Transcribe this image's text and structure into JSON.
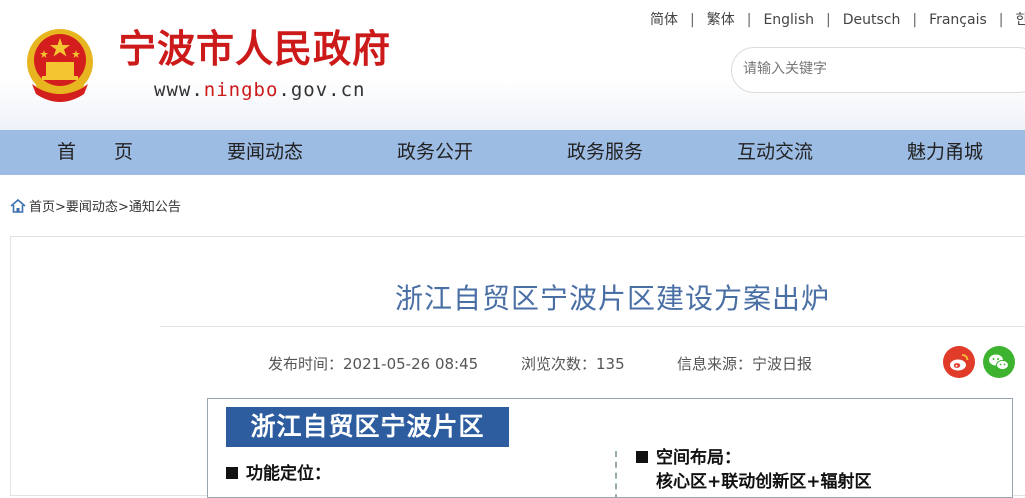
{
  "header": {
    "site_title": "宁波市人民政府",
    "site_url_prefix": "www.",
    "site_url_highlight": "ningbo",
    "site_url_suffix": ".gov.cn",
    "languages": [
      "简体",
      "繁体",
      "English",
      "Deutsch",
      "Français",
      "한국어"
    ],
    "search_placeholder": "请输入关键字"
  },
  "nav": {
    "items": [
      "首　　页",
      "要闻动态",
      "政务公开",
      "政务服务",
      "互动交流",
      "魅力甬城"
    ]
  },
  "breadcrumb": {
    "home": "首页",
    "sep1": ">",
    "level1": "要闻动态",
    "sep2": ">",
    "level2": "通知公告"
  },
  "article": {
    "title": "浙江自贸区宁波片区建设方案出炉",
    "publish_time": "发布时间：2021-05-26 08:45",
    "views": "浏览次数：135",
    "source": "信息来源：宁波日报"
  },
  "share": {
    "icons": [
      "weibo-icon",
      "wechat-icon"
    ]
  },
  "infographic": {
    "banner": "浙江自贸区宁波片区",
    "section_left": "功能定位：",
    "section_right": "空间布局：",
    "right_detail": "核心区+联动创新区+辐射区"
  },
  "colors": {
    "brand_red": "#cc1a1a",
    "nav_blue": "#9dbce4",
    "title_blue": "#4a6fa5",
    "banner_blue": "#2d5c9f"
  }
}
